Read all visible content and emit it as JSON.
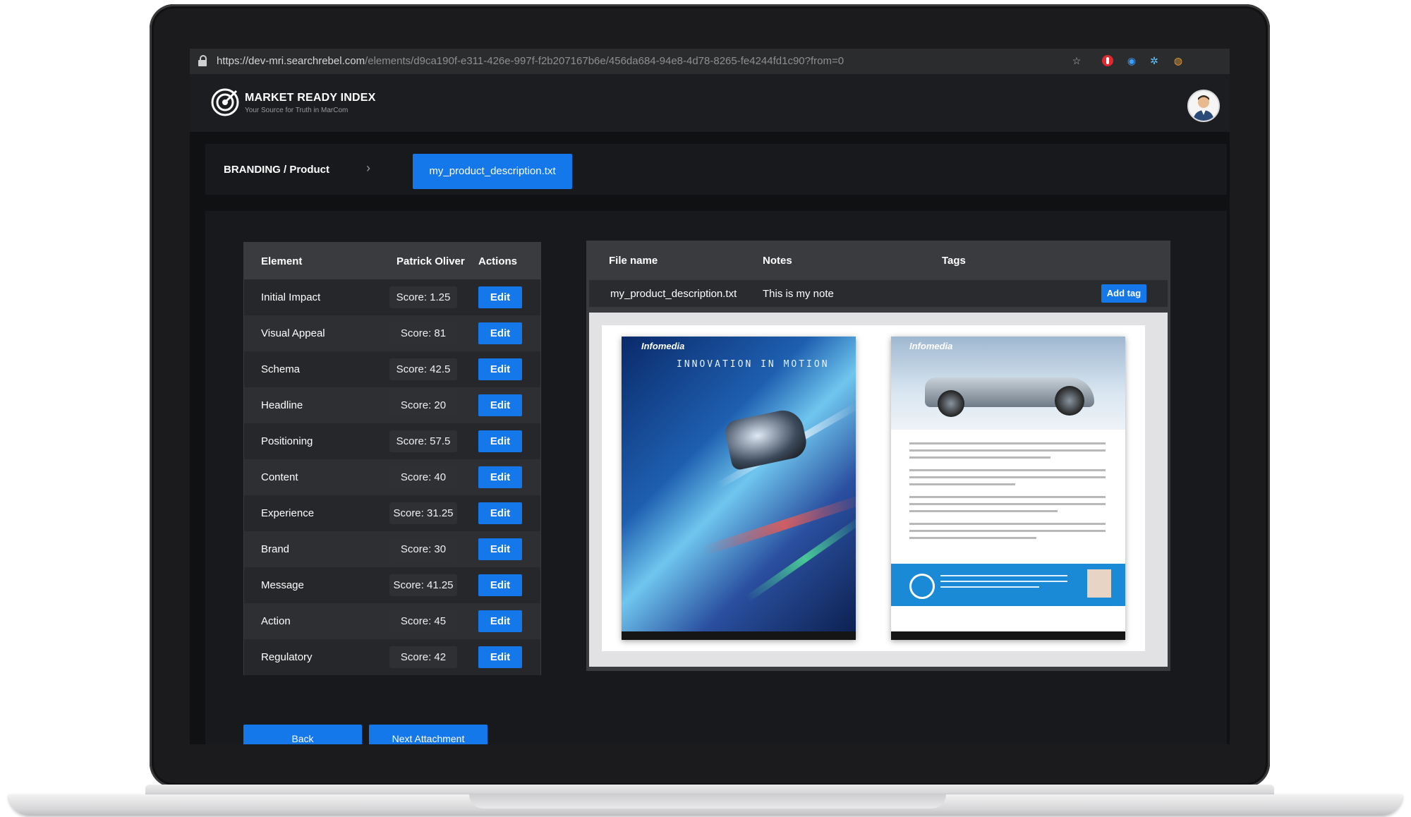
{
  "browser": {
    "url_host": "https://dev-mri.searchrebel.com",
    "url_path": "/elements/d9ca190f-e311-426e-997f-f2b207167b6e/456da684-94e8-4d78-8265-fe4244fd1c90?from=0"
  },
  "app": {
    "brand_title": "MARKET READY INDEX",
    "brand_subtitle": "Your Source for Truth in MarCom"
  },
  "breadcrumb": {
    "path": "BRANDING / Product",
    "file": "my_product_description.txt"
  },
  "scores": {
    "headers": {
      "element": "Element",
      "reviewer": "Patrick Oliver",
      "actions": "Actions"
    },
    "edit_label": "Edit",
    "rows": [
      {
        "element": "Initial Impact",
        "score": "Score: 1.25"
      },
      {
        "element": "Visual Appeal",
        "score": "Score: 81"
      },
      {
        "element": "Schema",
        "score": "Score: 42.5"
      },
      {
        "element": "Headline",
        "score": "Score: 20"
      },
      {
        "element": "Positioning",
        "score": "Score: 57.5"
      },
      {
        "element": "Content",
        "score": "Score: 40"
      },
      {
        "element": "Experience",
        "score": "Score: 31.25"
      },
      {
        "element": "Brand",
        "score": "Score: 30"
      },
      {
        "element": "Message",
        "score": "Score: 41.25"
      },
      {
        "element": "Action",
        "score": "Score: 45"
      },
      {
        "element": "Regulatory",
        "score": "Score: 42"
      }
    ]
  },
  "file_panel": {
    "headers": {
      "file_name": "File name",
      "notes": "Notes",
      "tags": "Tags"
    },
    "file_name": "my_product_description.txt",
    "note": "This is my note",
    "add_tag": "Add tag",
    "preview": {
      "page1_logo": "Infomedia",
      "page1_title": "INNOVATION IN MOTION",
      "page2_logo": "Infomedia"
    }
  },
  "footer_buttons": {
    "back": "Back",
    "next": "Next Attachment"
  },
  "colors": {
    "accent": "#1478ea",
    "background": "#101112",
    "panel": "#2a2b2e"
  }
}
